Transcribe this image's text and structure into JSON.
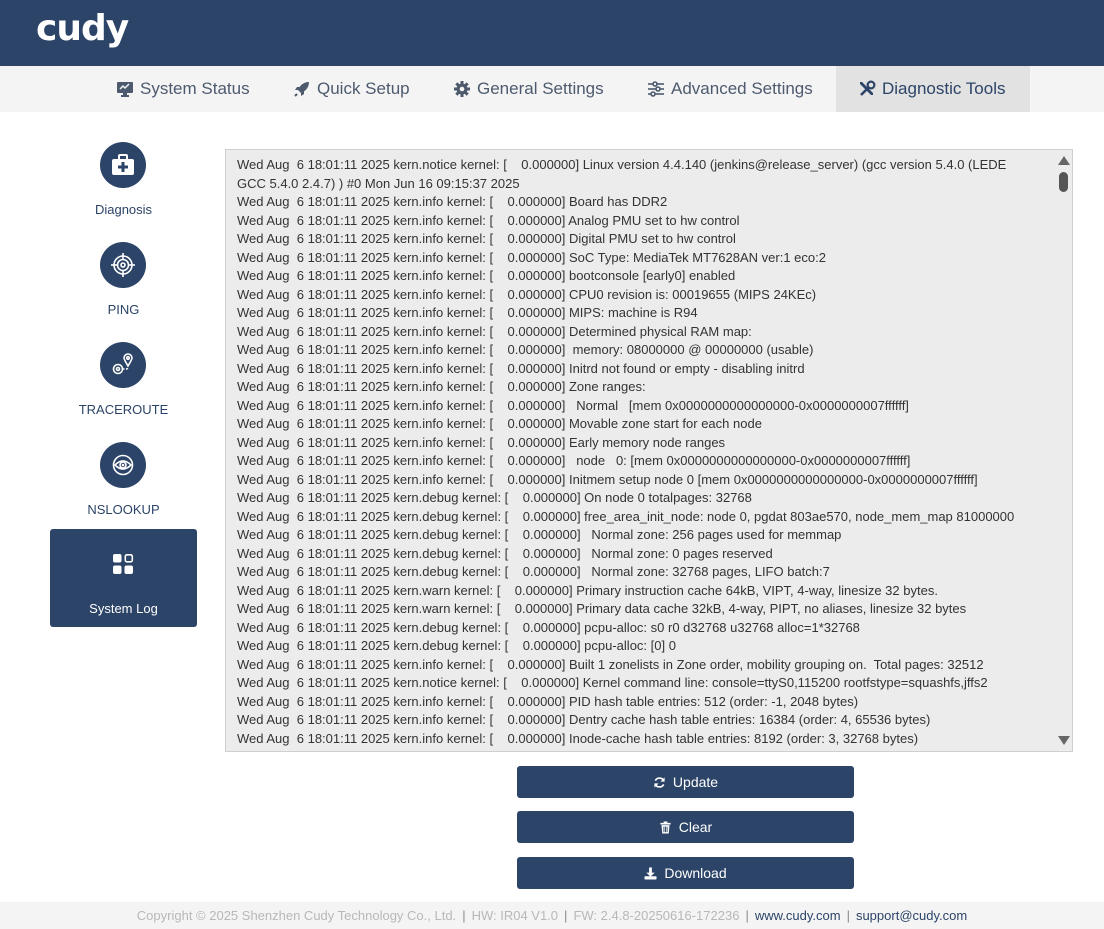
{
  "header": {
    "logo": "cudy"
  },
  "nav": {
    "tabs": [
      {
        "label": "System Status",
        "icon": "monitor-icon"
      },
      {
        "label": "Quick Setup",
        "icon": "rocket-icon"
      },
      {
        "label": "General Settings",
        "icon": "gear-icon"
      },
      {
        "label": "Advanced Settings",
        "icon": "sliders-icon"
      },
      {
        "label": "Diagnostic Tools",
        "icon": "tools-icon",
        "active": true
      }
    ]
  },
  "sidebar": {
    "items": [
      {
        "label": "Diagnosis",
        "icon": "first-aid-kit-icon"
      },
      {
        "label": "PING",
        "icon": "target-icon"
      },
      {
        "label": "TRACEROUTE",
        "icon": "route-pin-icon"
      },
      {
        "label": "NSLOOKUP",
        "icon": "eye-icon"
      },
      {
        "label": "System Log",
        "icon": "grid-icon",
        "active": true
      }
    ]
  },
  "log": {
    "text": "Wed Aug  6 18:01:11 2025 kern.notice kernel: [    0.000000] Linux version 4.4.140 (jenkins@release_server) (gcc version 5.4.0 (LEDE GCC 5.4.0 2.4.7) ) #0 Mon Jun 16 09:15:37 2025\nWed Aug  6 18:01:11 2025 kern.info kernel: [    0.000000] Board has DDR2\nWed Aug  6 18:01:11 2025 kern.info kernel: [    0.000000] Analog PMU set to hw control\nWed Aug  6 18:01:11 2025 kern.info kernel: [    0.000000] Digital PMU set to hw control\nWed Aug  6 18:01:11 2025 kern.info kernel: [    0.000000] SoC Type: MediaTek MT7628AN ver:1 eco:2\nWed Aug  6 18:01:11 2025 kern.info kernel: [    0.000000] bootconsole [early0] enabled\nWed Aug  6 18:01:11 2025 kern.info kernel: [    0.000000] CPU0 revision is: 00019655 (MIPS 24KEc)\nWed Aug  6 18:01:11 2025 kern.info kernel: [    0.000000] MIPS: machine is R94\nWed Aug  6 18:01:11 2025 kern.info kernel: [    0.000000] Determined physical RAM map:\nWed Aug  6 18:01:11 2025 kern.info kernel: [    0.000000]  memory: 08000000 @ 00000000 (usable)\nWed Aug  6 18:01:11 2025 kern.info kernel: [    0.000000] Initrd not found or empty - disabling initrd\nWed Aug  6 18:01:11 2025 kern.info kernel: [    0.000000] Zone ranges:\nWed Aug  6 18:01:11 2025 kern.info kernel: [    0.000000]   Normal   [mem 0x0000000000000000-0x0000000007ffffff]\nWed Aug  6 18:01:11 2025 kern.info kernel: [    0.000000] Movable zone start for each node\nWed Aug  6 18:01:11 2025 kern.info kernel: [    0.000000] Early memory node ranges\nWed Aug  6 18:01:11 2025 kern.info kernel: [    0.000000]   node   0: [mem 0x0000000000000000-0x0000000007ffffff]\nWed Aug  6 18:01:11 2025 kern.info kernel: [    0.000000] Initmem setup node 0 [mem 0x0000000000000000-0x0000000007ffffff]\nWed Aug  6 18:01:11 2025 kern.debug kernel: [    0.000000] On node 0 totalpages: 32768\nWed Aug  6 18:01:11 2025 kern.debug kernel: [    0.000000] free_area_init_node: node 0, pgdat 803ae570, node_mem_map 81000000\nWed Aug  6 18:01:11 2025 kern.debug kernel: [    0.000000]   Normal zone: 256 pages used for memmap\nWed Aug  6 18:01:11 2025 kern.debug kernel: [    0.000000]   Normal zone: 0 pages reserved\nWed Aug  6 18:01:11 2025 kern.debug kernel: [    0.000000]   Normal zone: 32768 pages, LIFO batch:7\nWed Aug  6 18:01:11 2025 kern.warn kernel: [    0.000000] Primary instruction cache 64kB, VIPT, 4-way, linesize 32 bytes.\nWed Aug  6 18:01:11 2025 kern.warn kernel: [    0.000000] Primary data cache 32kB, 4-way, PIPT, no aliases, linesize 32 bytes\nWed Aug  6 18:01:11 2025 kern.debug kernel: [    0.000000] pcpu-alloc: s0 r0 d32768 u32768 alloc=1*32768\nWed Aug  6 18:01:11 2025 kern.debug kernel: [    0.000000] pcpu-alloc: [0] 0\nWed Aug  6 18:01:11 2025 kern.info kernel: [    0.000000] Built 1 zonelists in Zone order, mobility grouping on.  Total pages: 32512\nWed Aug  6 18:01:11 2025 kern.notice kernel: [    0.000000] Kernel command line: console=ttyS0,115200 rootfstype=squashfs,jffs2\nWed Aug  6 18:01:11 2025 kern.info kernel: [    0.000000] PID hash table entries: 512 (order: -1, 2048 bytes)\nWed Aug  6 18:01:11 2025 kern.info kernel: [    0.000000] Dentry cache hash table entries: 16384 (order: 4, 65536 bytes)\nWed Aug  6 18:01:11 2025 kern.info kernel: [    0.000000] Inode-cache hash table entries: 8192 (order: 3, 32768 bytes)"
  },
  "buttons": {
    "update": "Update",
    "clear": "Clear",
    "download": "Download"
  },
  "footer": {
    "copyright": "Copyright © 2025 Shenzhen Cudy Technology Co., Ltd.",
    "hw": "HW: IR04 V1.0",
    "fw": "FW: 2.4.8-20250616-172236",
    "website": "www.cudy.com",
    "email": "support@cudy.com"
  },
  "colors": {
    "brand": "#2c4467",
    "nav_bg": "#f4f4f4",
    "log_bg": "#ececec"
  }
}
